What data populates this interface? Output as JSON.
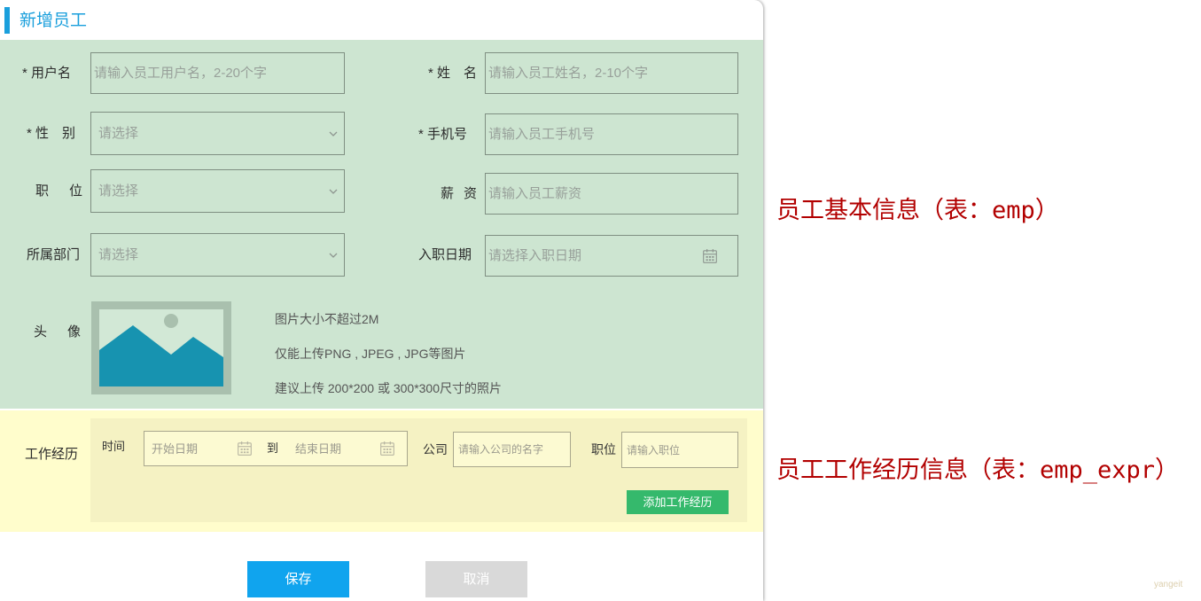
{
  "form": {
    "title": "新增员工",
    "basic_info": {
      "username": {
        "label": "* 用户名",
        "placeholder": "请输入员工用户名，2-20个字"
      },
      "name": {
        "label": "* 姓　名",
        "placeholder": "请输入员工姓名，2-10个字"
      },
      "gender": {
        "label": "* 性　别",
        "placeholder": "请选择"
      },
      "phone": {
        "label": "* 手机号",
        "placeholder": "请输入员工手机号"
      },
      "job": {
        "label": "职　位",
        "placeholder": "请选择"
      },
      "salary": {
        "label": "薪　资",
        "placeholder": "请输入员工薪资"
      },
      "department": {
        "label": "所属部门",
        "placeholder": "请选择"
      },
      "entry_date": {
        "label": "入职日期",
        "placeholder": "请选择入职日期"
      },
      "avatar": {
        "label": "头　像",
        "hints": [
          "图片大小不超过2M",
          "仅能上传PNG , JPEG , JPG等图片",
          "建议上传 200*200 或 300*300尺寸的照片"
        ]
      }
    },
    "work_experience": {
      "label": "工作经历",
      "time": {
        "label": "时间",
        "start_placeholder": "开始日期",
        "separator": "到",
        "end_placeholder": "结束日期"
      },
      "company": {
        "label": "公司",
        "placeholder": "请输入公司的名字"
      },
      "job": {
        "label": "职位",
        "placeholder": "请输入职位"
      },
      "add_button": "添加工作经历"
    },
    "actions": {
      "save": "保存",
      "cancel": "取消"
    }
  },
  "annotations": {
    "basic_info": "员工基本信息（表：emp）",
    "work_experience": "员工工作经历信息（表：emp_expr）"
  },
  "watermark": "yangeit",
  "icons": {
    "select_arrow": "chevron-down-icon",
    "date_picker": "calendar-icon",
    "avatar_placeholder": "image-placeholder-icon"
  },
  "colors": {
    "accent": "#1a9fdc",
    "basic_section_bg": "#cde5d1",
    "experience_section_bg": "#fffdcc",
    "save_button": "#10a4ee",
    "cancel_button": "#d9d9d9",
    "add_button": "#35b96c",
    "annotation_text": "#b20000"
  }
}
